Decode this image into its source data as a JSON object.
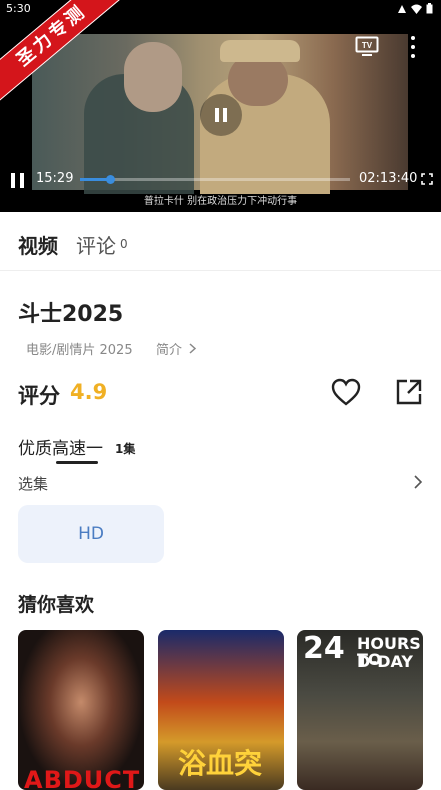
{
  "status": {
    "time": "5:30"
  },
  "badge": {
    "text": "圣力专测"
  },
  "player": {
    "current_time": "15:29",
    "total_time": "02:13:40",
    "subtitle": "普拉卡什 别在政治压力下冲动行事",
    "progress": 0.11,
    "tv_label": "TV"
  },
  "tabs": {
    "video": "视频",
    "comment": "评论",
    "comment_count": "0"
  },
  "movie": {
    "title": "斗士2025",
    "meta": "电影/剧情片  2025",
    "intro": "简介"
  },
  "rating": {
    "label": "评分",
    "value": "4.9"
  },
  "source": {
    "name": "优质高速一",
    "count": "1集"
  },
  "episodes": {
    "label": "选集",
    "items": [
      "HD"
    ]
  },
  "recommend": {
    "title": "猜你喜欢",
    "posters": [
      {
        "text": "ABDUCT"
      },
      {
        "text": "浴血突围"
      },
      {
        "text_a": "24",
        "text_b": "HOURS TO",
        "text_c": "D-DAY"
      }
    ]
  },
  "colors": {
    "accent": "#3a8dde",
    "rating": "#f0b024",
    "badge": "#d4151b",
    "episode_text": "#4a7cc2"
  }
}
